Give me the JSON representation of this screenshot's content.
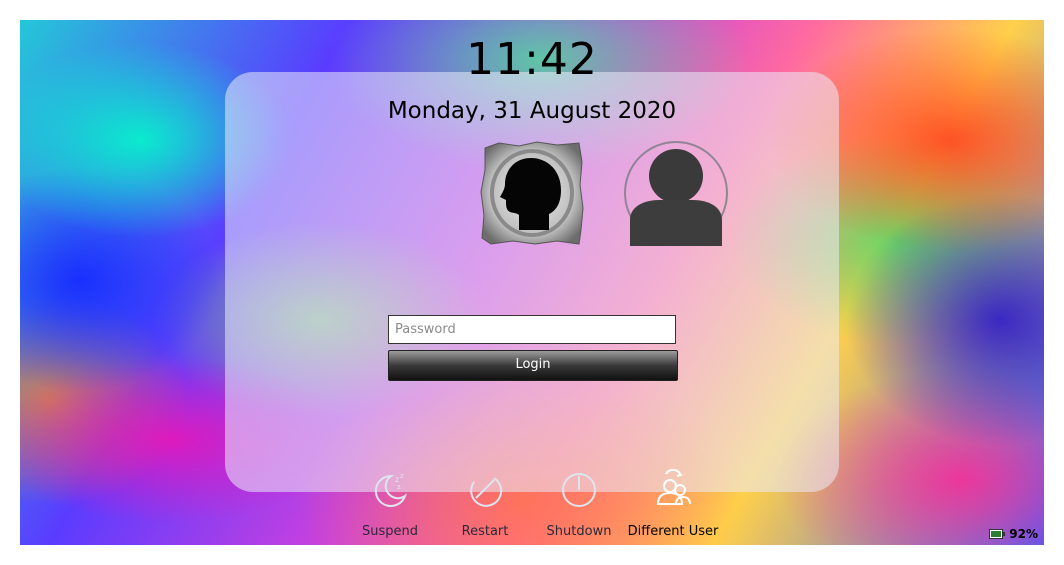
{
  "clock": {
    "time": "11:42"
  },
  "date": {
    "text": "Monday, 31 August 2020"
  },
  "users": [
    {
      "name": "",
      "icon": "user-head-silhouette-icon",
      "selected": true
    },
    {
      "name": "",
      "icon": "default-user-avatar-icon",
      "selected": false
    }
  ],
  "login_form": {
    "password_placeholder": "Password",
    "password_value": "",
    "login_label": "Login"
  },
  "actions": [
    {
      "label": "Suspend",
      "icon": "suspend-moon-icon"
    },
    {
      "label": "Restart",
      "icon": "restart-icon"
    },
    {
      "label": "Shutdown",
      "icon": "shutdown-icon"
    },
    {
      "label": "Different User",
      "icon": "switch-user-icon"
    }
  ],
  "status": {
    "battery_percent": "92%",
    "battery_icon": "battery-icon"
  },
  "colors": {
    "panel": "#ebebfa",
    "login_button": "#1a1a1a",
    "text": "#000000"
  }
}
